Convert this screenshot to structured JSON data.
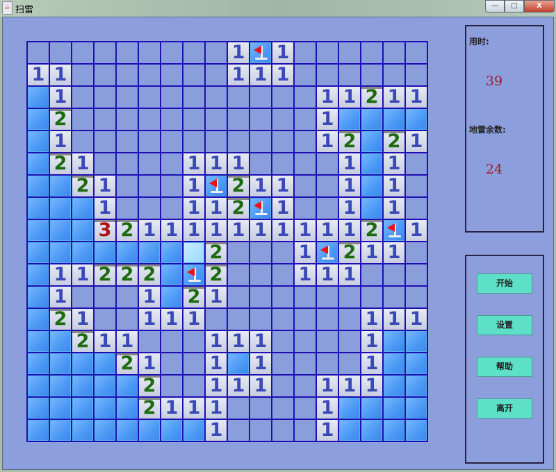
{
  "window": {
    "title": "扫雷",
    "minimize": "—",
    "maximize": "□",
    "close": "X"
  },
  "board": {
    "legend": {
      ".": "revealed-empty",
      "#": "covered",
      "F": "flagged",
      "H": "covered-highlighted",
      "1-9": "number"
    },
    "rows": [
      ".........1F1......",
      "11.......111......",
      "#1...........11211",
      "#2...........1####",
      "#1...........12#21",
      "#21....111....1#1.",
      "##21...1F211..1#1.",
      "###1...112F1..1#1.",
      "###3211111111112F1",
      "#######H2...1F211.",
      "#11222#F2...111...",
      "#1...1#21.........",
      "#21..111.......111",
      "##211...111....1##",
      "####21..1#1....1##",
      "#####2..111..111##",
      "#####2111....1####",
      "########1....1####"
    ]
  },
  "info": {
    "time_label": "用时:",
    "time_value": "39",
    "mines_label": "地雷余数:",
    "mines_value": "24"
  },
  "controls": {
    "start": "开始",
    "settings": "设置",
    "help": "帮助",
    "exit": "离开"
  }
}
